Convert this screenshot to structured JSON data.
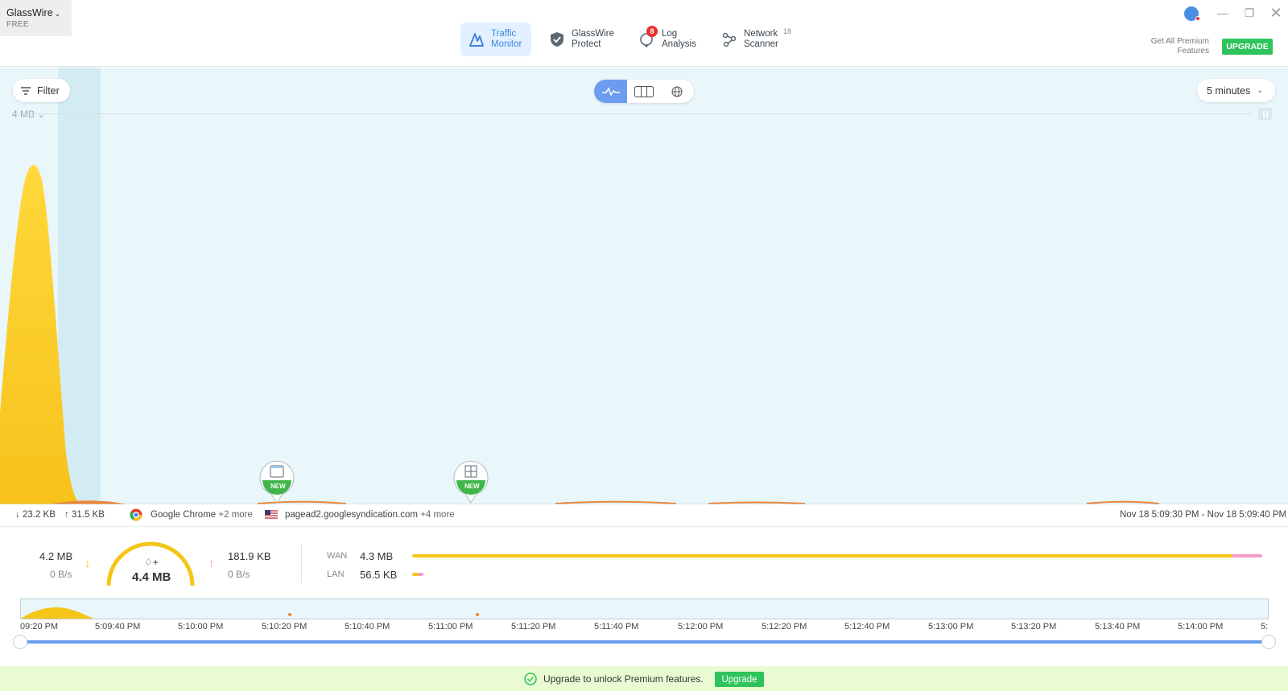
{
  "app": {
    "name": "GlassWire",
    "tier": "FREE"
  },
  "nav": {
    "tabs": [
      {
        "label": "Traffic\nMonitor",
        "active": true
      },
      {
        "label": "GlassWire\nProtect",
        "active": false
      },
      {
        "label": "Log\nAnalysis",
        "active": false,
        "badge": "8"
      },
      {
        "label": "Network\nScanner",
        "active": false,
        "count": "18"
      }
    ]
  },
  "header": {
    "premium_text": "Get All Premium Features",
    "upgrade_label": "UPGRADE"
  },
  "graph": {
    "filter_label": "Filter",
    "range_label": "5 minutes",
    "scale_label": "4 MB",
    "pins": [
      {
        "badge": "NEW",
        "icon": "app-window-icon"
      },
      {
        "badge": "NEW",
        "icon": "app-installer-icon"
      }
    ]
  },
  "info": {
    "download": "23.2 KB",
    "upload": "31.5 KB",
    "app": "Google Chrome",
    "app_more": "+2 more",
    "host": "pagead2.googlesyndication.com",
    "host_more": "+4 more",
    "time_range": "Nov 18 5:09:30 PM - Nov 18 5:09:40 PM"
  },
  "usage": {
    "download_total": "4.2 MB",
    "download_rate": "0 B/s",
    "total": "4.4 MB",
    "upload_total": "181.9 KB",
    "upload_rate": "0 B/s",
    "wan_label": "WAN",
    "wan_value": "4.3 MB",
    "lan_label": "LAN",
    "lan_value": "56.5 KB",
    "colors": {
      "download": "#f5c518",
      "upload": "#f29cc3",
      "accent": "#2ec35b",
      "link": "#6b9cf0"
    }
  },
  "timeline": {
    "ticks": [
      "09:20 PM",
      "5:09:40 PM",
      "5:10:00 PM",
      "5:10:20 PM",
      "5:10:40 PM",
      "5:11:00 PM",
      "5:11:20 PM",
      "5:11:40 PM",
      "5:12:00 PM",
      "5:12:20 PM",
      "5:12:40 PM",
      "5:13:00 PM",
      "5:13:20 PM",
      "5:13:40 PM",
      "5:14:00 PM",
      "5:"
    ]
  },
  "banner": {
    "text": "Upgrade to unlock Premium features.",
    "button_label": "Upgrade"
  }
}
